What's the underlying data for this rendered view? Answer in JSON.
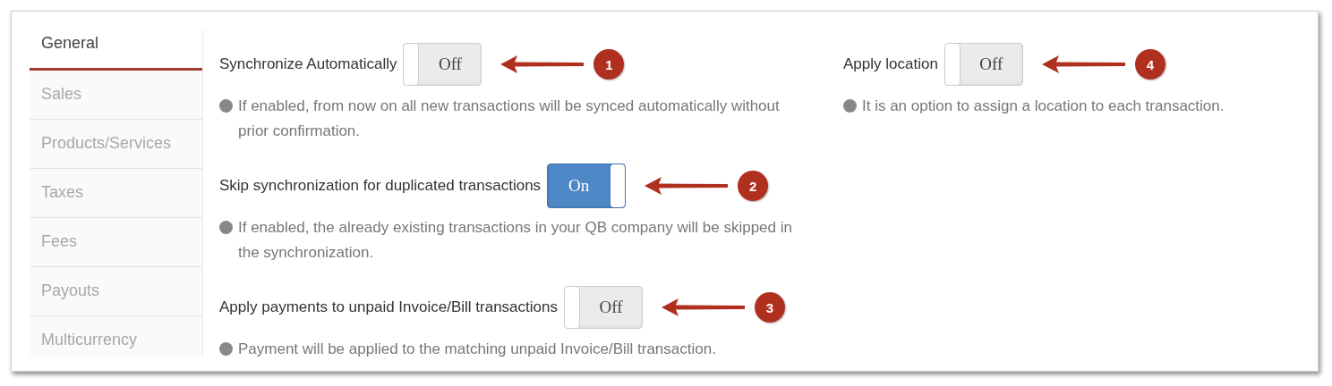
{
  "tabs": [
    {
      "label": "General",
      "selected": true
    },
    {
      "label": "Sales",
      "selected": false
    },
    {
      "label": "Products/Services",
      "selected": false
    },
    {
      "label": "Taxes",
      "selected": false
    },
    {
      "label": "Fees",
      "selected": false
    },
    {
      "label": "Payouts",
      "selected": false
    },
    {
      "label": "Multicurrency",
      "selected": false
    }
  ],
  "columns": [
    {
      "settings": [
        {
          "label": "Synchronize Automatically",
          "on": false,
          "toggle_text": "Off",
          "callout": "1",
          "hint": "If enabled, from now on all new transactions will be synced automatically without prior confirmation."
        },
        {
          "label": "Skip synchronization for duplicated transactions",
          "on": true,
          "toggle_text": "On",
          "callout": "2",
          "hint": "If enabled, the already existing transactions in your QB company will be skipped in the synchronization."
        },
        {
          "label": "Apply payments to unpaid Invoice/Bill transactions",
          "on": false,
          "toggle_text": "Off",
          "callout": "3",
          "hint": "Payment will be applied to the matching unpaid Invoice/Bill transaction."
        }
      ]
    },
    {
      "settings": [
        {
          "label": "Apply location",
          "on": false,
          "toggle_text": "Off",
          "callout": "4",
          "hint": "It is an option to assign a location to each transaction."
        }
      ]
    }
  ]
}
